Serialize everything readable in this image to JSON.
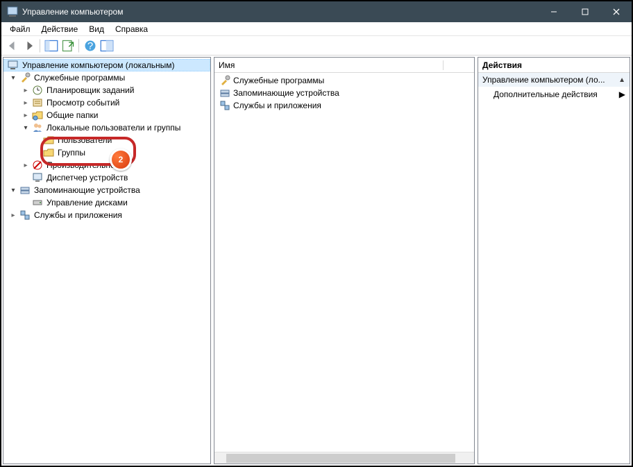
{
  "title": "Управление компьютером",
  "menu": {
    "file": "Файл",
    "action": "Действие",
    "view": "Вид",
    "help": "Справка"
  },
  "tree": {
    "root": "Управление компьютером (локальным)",
    "n1": "Служебные программы",
    "n1a": "Планировщик заданий",
    "n1b": "Просмотр событий",
    "n1c": "Общие папки",
    "n1d": "Локальные пользователи и группы",
    "n1d1": "Пользователи",
    "n1d2": "Группы",
    "n1e": "Производительность",
    "n1f": "Диспетчер устройств",
    "n2": "Запоминающие устройства",
    "n2a": "Управление дисками",
    "n3": "Службы и приложения"
  },
  "center": {
    "header": "Имя",
    "items": [
      "Служебные программы",
      "Запоминающие устройства",
      "Службы и приложения"
    ]
  },
  "right": {
    "header": "Действия",
    "context": "Управление компьютером (ло...",
    "more": "Дополнительные действия"
  },
  "annotation": {
    "number": "2"
  }
}
